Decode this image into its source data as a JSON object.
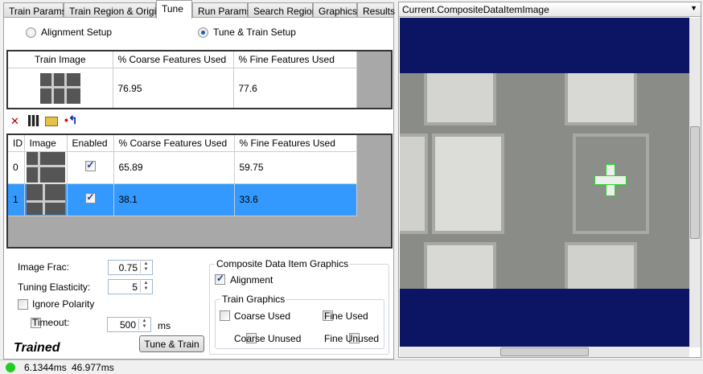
{
  "tabs": [
    "Train Params",
    "Train Region & Origin",
    "Tune",
    "Run Params",
    "Search Region",
    "Graphics",
    "Results"
  ],
  "active_tab": "Tune",
  "mode": {
    "alignment_label": "Alignment Setup",
    "tune_label": "Tune & Train Setup",
    "selected": "Tune & Train Setup"
  },
  "train_table": {
    "headers": [
      "Train Image",
      "% Coarse Features Used",
      "% Fine Features Used"
    ],
    "row": {
      "coarse": "76.95",
      "fine": "77.6"
    }
  },
  "toolbar": {
    "icons": [
      "delete-icon",
      "save-icon",
      "open-folder-icon",
      "import-icon"
    ]
  },
  "items_table": {
    "headers": [
      "ID",
      "Image",
      "Enabled",
      "% Coarse Features Used",
      "% Fine Features Used"
    ],
    "rows": [
      {
        "id": "0",
        "enabled": true,
        "coarse": "65.89",
        "fine": "59.75"
      },
      {
        "id": "1",
        "enabled": true,
        "coarse": "38.1",
        "fine": "33.6",
        "selected": true
      }
    ]
  },
  "params": {
    "image_frac_label": "Image Frac:",
    "image_frac": "0.75",
    "elasticity_label": "Tuning Elasticity:",
    "elasticity": "5",
    "ignore_polarity_label": "Ignore Polarity",
    "ignore_polarity": false,
    "timeout_label": "Timeout:",
    "timeout_enabled": false,
    "timeout": "500",
    "timeout_unit": "ms"
  },
  "tune_button": "Tune & Train",
  "trained_label": "Trained",
  "graphics": {
    "title": "Composite Data Item Graphics",
    "alignment_label": "Alignment",
    "alignment": true,
    "train_title": "Train Graphics",
    "coarse_used": "Coarse Used",
    "fine_used": "Fine Used",
    "coarse_unused": "Coarse Unused",
    "fine_unused": "Fine Unused"
  },
  "viewer": {
    "title": "Current.CompositeDataItemImage",
    "background": "#0c1464",
    "selection_color": "#3399ff",
    "overlay_color": "#22dd22"
  },
  "status": {
    "indicator_color": "#22cc22",
    "time1": "6.1344ms",
    "time2": "46.977ms"
  }
}
